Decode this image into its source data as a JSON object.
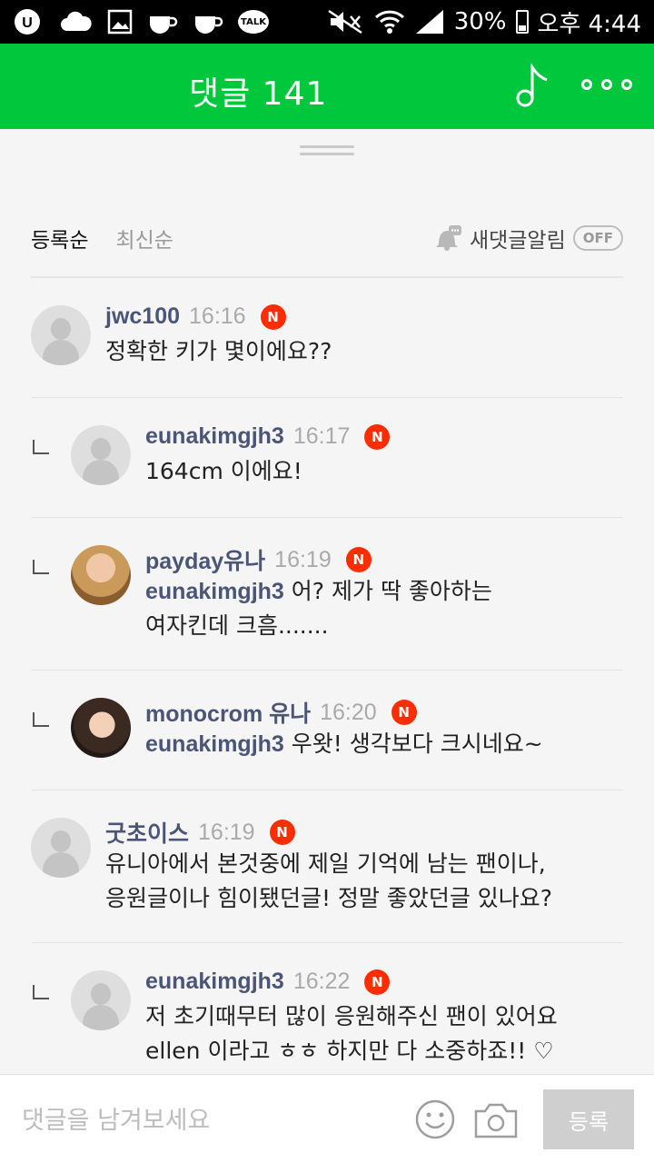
{
  "status_bar": {
    "battery": "30%",
    "time": "오후 4:44",
    "talk_label": "TALK"
  },
  "header": {
    "title": "댓글 141"
  },
  "tabs": {
    "registration_order": "등록순",
    "latest_order": "최신순",
    "alarm_label": "새댓글알림",
    "alarm_toggle": "OFF"
  },
  "comments": [
    {
      "author": "jwc100",
      "time": "16:16",
      "badge": "N",
      "reply": false,
      "mention": "",
      "text": "정확한 키가 몇이에요??"
    },
    {
      "author": "eunakimgjh3",
      "time": "16:17",
      "badge": "N",
      "reply": true,
      "mention": "",
      "text": "164cm 이에요!"
    },
    {
      "author": "payday유나",
      "time": "16:19",
      "badge": "N",
      "reply": true,
      "mention": "eunakimgjh3",
      "text": " 어? 제가 딱 좋아하는",
      "text2": "여자킨데 크흠......."
    },
    {
      "author": "monocrom 유나",
      "time": "16:20",
      "badge": "N",
      "reply": true,
      "mention": "eunakimgjh3",
      "text": " 우왓! 생각보다 크시네요~"
    },
    {
      "author": "굿초이스",
      "time": "16:19",
      "badge": "N",
      "reply": false,
      "mention": "",
      "text": "유니아에서 본것중에 제일 기억에 남는 팬이나,",
      "text2": "응원글이나 힘이됐던글! 정말 좋았던글 있나요?"
    },
    {
      "author": "eunakimgjh3",
      "time": "16:22",
      "badge": "N",
      "reply": true,
      "mention": "",
      "text": "저 초기때무터 많이 응원해주신 팬이 있어요",
      "text2": "ellen 이라고 ㅎㅎ 하지만 다 소중하죠!! ♡"
    }
  ],
  "input_bar": {
    "placeholder": "댓글을 남겨보세요",
    "submit_label": "등록"
  }
}
